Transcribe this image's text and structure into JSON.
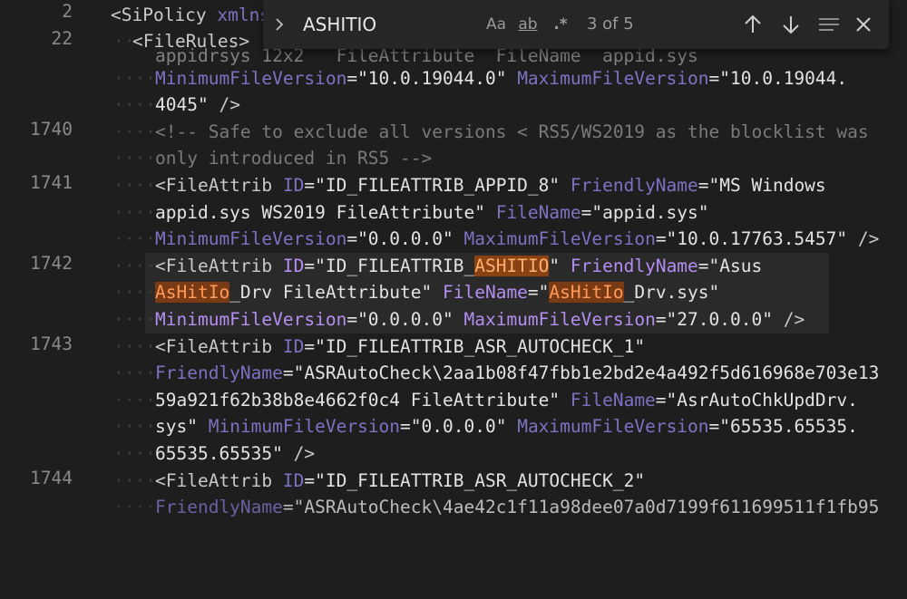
{
  "find": {
    "query": "ASHITIO",
    "match_count": "3 of 5",
    "toggle_label": ">",
    "match_case_label": "Aa",
    "whole_word_label": "ab",
    "regex_label": ".*"
  },
  "colors": {
    "accent": "#b48ef0",
    "highlight": "#7a3a14",
    "highlight_text": "#ff9a5a"
  },
  "gutter": [
    "2",
    "22",
    "1740",
    "1741",
    "1742",
    "1743",
    "1744"
  ],
  "lines": {
    "l2": {
      "tag": "<SiPolicy",
      "attr": "xmlns"
    },
    "l22": {
      "tag": "<FileRules>"
    },
    "clipped": "appidrsys 12x2   FileAttribute  FileName  appid.sys",
    "wrap_a": {
      "a1": "MinimumFileVersion",
      "v1": "=\"10.0.19044.0\"",
      "a2": "MaximumFileVersion",
      "v2": "=\"10.0.19044."
    },
    "wrap_b": {
      "v": "4045\"",
      "end": "/>"
    },
    "c1740_a": "<!-- Safe to exclude all versions < RS5/WS2019 as the blocklist was",
    "c1740_b": "only introduced in RS5 -->",
    "l1741": {
      "tag": "<FileAttrib",
      "id_attr": "ID",
      "id_val": "=\"ID_FILEATTRIB_APPID_8\"",
      "fn_attr": "FriendlyName",
      "fn_val": "=\"MS Windows",
      "fn_val2": "appid.sys WS2019 FileAttribute\"",
      "file_attr": "FileName",
      "file_val": "=\"appid.sys\"",
      "min_attr": "MinimumFileVersion",
      "min_val": "=\"0.0.0.0\"",
      "max_attr": "MaximumFileVersion",
      "max_val": "=\"10.0.17763.5457\"",
      "end": "/>"
    },
    "l1742": {
      "tag": "<FileAttrib",
      "id_attr": "ID",
      "id_pre": "=\"ID_FILEATTRIB_",
      "id_match": "ASHITIO",
      "id_post": "\"",
      "fn_attr": "FriendlyName",
      "fn_val": "=\"Asus",
      "fn_match": "AsHitIo",
      "fn_post": "_Drv FileAttribute\"",
      "file_attr": "FileName",
      "file_pre": "=\"",
      "file_match": "AsHitIo",
      "file_post": "_Drv.sys\"",
      "min_attr": "MinimumFileVersion",
      "min_val": "=\"0.0.0.0\"",
      "max_attr": "MaximumFileVersion",
      "max_val": "=\"27.0.0.0\"",
      "end": "/>"
    },
    "l1743": {
      "tag": "<FileAttrib",
      "id_attr": "ID",
      "id_val": "=\"ID_FILEATTRIB_ASR_AUTOCHECK_1\"",
      "fn_attr": "FriendlyName",
      "fn_val": "=\"ASRAutoCheck\\2aa1b08f47fbb1e2bd2e4a492f5d616968e703e13",
      "fn_val2": "59a921f62b38b8e4662f0c4 FileAttribute\"",
      "file_attr": "FileName",
      "file_val": "=\"AsrAutoChkUpdDrv.",
      "file_val2": "sys\"",
      "min_attr": "MinimumFileVersion",
      "min_val": "=\"0.0.0.0\"",
      "max_attr": "MaximumFileVersion",
      "max_val": "=\"65535.65535.",
      "max_val2": "65535.65535\"",
      "end": "/>"
    },
    "l1744": {
      "tag": "<FileAttrib",
      "id_attr": "ID",
      "id_val": "=\"ID_FILEATTRIB_ASR_AUTOCHECK_2\"",
      "fn_attr": "FriendlyName",
      "fn_val": "=\"ASRAutoCheck\\4ae42c1f11a98dee07a0d7199f611699511f1fb95"
    }
  }
}
